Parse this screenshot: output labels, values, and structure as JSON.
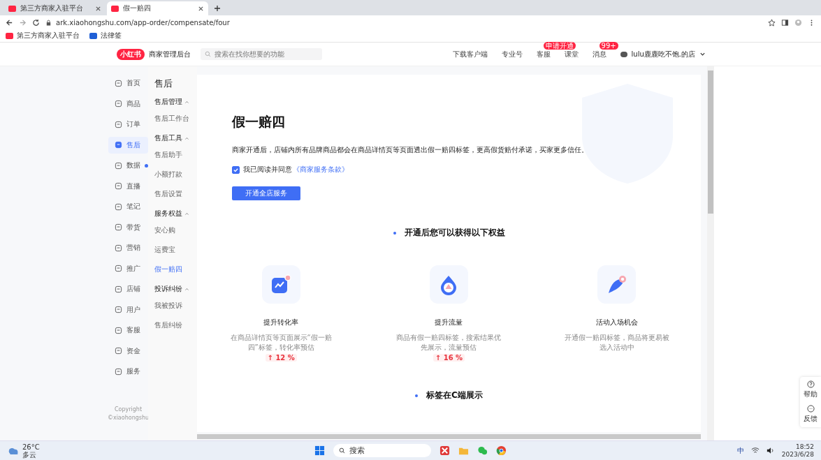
{
  "browser": {
    "tabs": [
      {
        "title": "第三方商家入驻平台",
        "selected": false
      },
      {
        "title": "假一赔四",
        "selected": true
      }
    ],
    "url": "ark.xiaohongshu.com/app-order/compensate/four",
    "bookmarks": [
      "第三方商家入驻平台",
      "法律签"
    ]
  },
  "header": {
    "logo": "小红书",
    "title": "商家管理后台",
    "search_placeholder": "搜索在找你想要的功能",
    "links": [
      {
        "label": "下载客户端"
      },
      {
        "label": "专业号"
      },
      {
        "label": "客服",
        "badge": "申请开通"
      },
      {
        "label": "课堂"
      },
      {
        "label": "消息",
        "badge": "99+"
      }
    ],
    "user": "lulu鹿鹿吃不饱.的店"
  },
  "nav": [
    {
      "label": "首页",
      "selected": false,
      "dot": false
    },
    {
      "label": "商品",
      "selected": false,
      "dot": false
    },
    {
      "label": "订单",
      "selected": false,
      "dot": false
    },
    {
      "label": "售后",
      "selected": true,
      "dot": false
    },
    {
      "label": "数据",
      "selected": false,
      "dot": true
    },
    {
      "label": "直播",
      "selected": false,
      "dot": false
    },
    {
      "label": "笔记",
      "selected": false,
      "dot": false
    },
    {
      "label": "带货",
      "selected": false,
      "dot": false
    },
    {
      "label": "营销",
      "selected": false,
      "dot": false
    },
    {
      "label": "推广",
      "selected": false,
      "dot": false
    },
    {
      "label": "店铺",
      "selected": false,
      "dot": false
    },
    {
      "label": "用户",
      "selected": false,
      "dot": false
    },
    {
      "label": "客服",
      "selected": false,
      "dot": false
    },
    {
      "label": "资金",
      "selected": false,
      "dot": false
    },
    {
      "label": "服务",
      "selected": false,
      "dot": false
    }
  ],
  "copyright": [
    "Copyright",
    "©xiaohongshu"
  ],
  "submenu": {
    "title": "售后",
    "groups": [
      {
        "label": "售后管理",
        "expanded": true,
        "items": [
          {
            "label": "售后工作台",
            "selected": false
          }
        ]
      },
      {
        "label": "售后工具",
        "expanded": true,
        "items": [
          {
            "label": "售后助手",
            "selected": false
          },
          {
            "label": "小额打款",
            "selected": false
          },
          {
            "label": "售后设置",
            "selected": false
          }
        ]
      },
      {
        "label": "服务权益",
        "expanded": true,
        "items": [
          {
            "label": "安心购",
            "selected": false
          },
          {
            "label": "运费宝",
            "selected": false
          },
          {
            "label": "假一赔四",
            "selected": true
          }
        ]
      },
      {
        "label": "投诉纠纷",
        "expanded": true,
        "items": [
          {
            "label": "我被投诉",
            "selected": false
          },
          {
            "label": "售后纠纷",
            "selected": false
          }
        ]
      }
    ]
  },
  "content": {
    "title": "假一赔四",
    "description": "商家开通后，店铺内所有品牌商品都会在商品详情页等页面透出假一赔四标签，更高假货赔付承诺，买家更多信任。",
    "agreement": {
      "checked": true,
      "text": "我已阅读并同意",
      "link": "《商家服务条款》"
    },
    "button": "开通全店服务",
    "benefits_heading": "开通后您可以获得以下权益",
    "benefits": [
      {
        "kind": "chart",
        "title": "提升转化率",
        "description": "在商品详情页等页面展示“假一赔四”标签，转化率预估",
        "badge": "↑ 12 %"
      },
      {
        "kind": "drop",
        "title": "提升流量",
        "description": "商品有假一赔四标签，搜索结果优先展示，流量预估",
        "badge": "↑ 16 %"
      },
      {
        "kind": "rocket",
        "title": "活动入场机会",
        "description": "开通假一赔四标签，商品将更易被选入活动中"
      }
    ],
    "display_heading": "标签在C端展示"
  },
  "float_tools": [
    "帮助",
    "反馈"
  ],
  "taskbar": {
    "temperature": "26°C",
    "weather": "多云",
    "search": "搜索",
    "ime": "中",
    "time": "18:52",
    "date": "2023/6/28"
  }
}
